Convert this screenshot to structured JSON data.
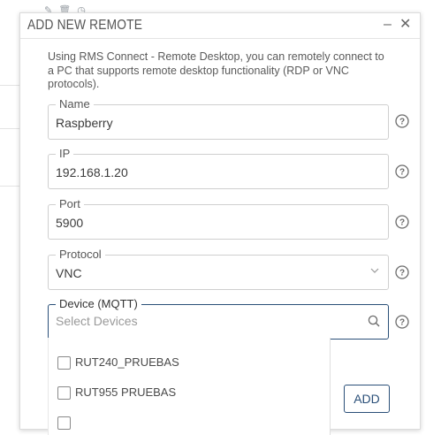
{
  "dialog": {
    "title": "ADD NEW REMOTE",
    "minimize_icon": "minimize-icon",
    "close_icon": "close-icon",
    "description": "Using RMS Connect - Remote Desktop, you can remotely connect to a PC that supports remote desktop functionality (RDP or VNC protocols)."
  },
  "fields": {
    "name": {
      "label": "Name",
      "value": "Raspberry"
    },
    "ip": {
      "label": "IP",
      "value": "192.168.1.20"
    },
    "port": {
      "label": "Port",
      "value": "5900"
    },
    "protocol": {
      "label": "Protocol",
      "value": "VNC"
    },
    "device": {
      "label": "Device (MQTT)",
      "placeholder": "Select Devices",
      "value": ""
    }
  },
  "device_options": [
    {
      "label": "RUT240_PRUEBAS",
      "checked": false
    },
    {
      "label": "RUT955 PRUEBAS",
      "checked": false
    }
  ],
  "buttons": {
    "add": "ADD"
  },
  "colors": {
    "accent": "#2a4f78",
    "border": "#cfcfcf",
    "text": "#404040"
  }
}
